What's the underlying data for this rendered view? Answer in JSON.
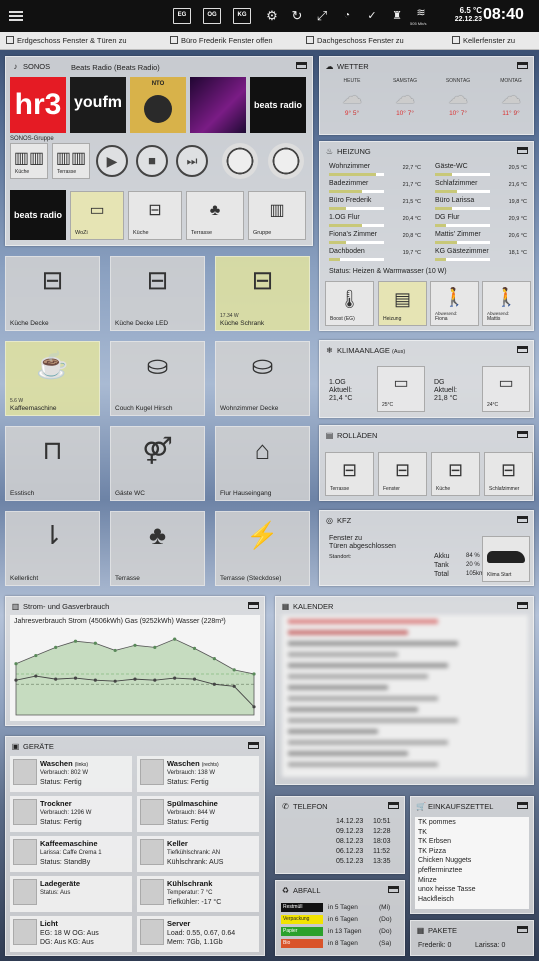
{
  "topbar": {
    "btn1": "EG",
    "btn2": "OG",
    "btn3": "KG",
    "temp": "6.5 °C",
    "date": "22.12.23",
    "time": "08:40",
    "wifi": "505 Mb/s"
  },
  "ticker": [
    "Erdgeschoss Fenster & Türen zu",
    "Büro Frederik Fenster offen",
    "Dachgeschoss Fenster zu",
    "Kellerfenster zu"
  ],
  "sonos": {
    "title": "SONOS",
    "now_playing": "Beats Radio (Beats Radio)",
    "stations": [
      "hr3",
      "youfm",
      "NTO",
      "",
      "beats radio"
    ],
    "group_label": "SONOS-Gruppe",
    "group": [
      "Küche",
      "Terrasse"
    ],
    "rooms": [
      "WoZi",
      "Küche",
      "Terrasse",
      "Gruppe"
    ],
    "logo": "beats radio"
  },
  "weather": {
    "title": "WETTER",
    "days": [
      {
        "d": "HEUTE",
        "lo": "9°",
        "hi": "5°"
      },
      {
        "d": "SAMSTAG",
        "lo": "10°",
        "hi": "7°"
      },
      {
        "d": "SONNTAG",
        "lo": "10°",
        "hi": "7°"
      },
      {
        "d": "MONTAG",
        "lo": "11°",
        "hi": "9°"
      }
    ]
  },
  "heating": {
    "title": "HEIZUNG",
    "left": [
      {
        "n": "Wohnzimmer",
        "v": "22,7 °C",
        "p": 0.85
      },
      {
        "n": "Badezimmer",
        "v": "21,7 °C",
        "p": 0.6
      },
      {
        "n": "Büro Frederik",
        "v": "21,5 °C",
        "p": 0.3
      },
      {
        "n": "1.OG Flur",
        "v": "20,4 °C",
        "p": 0.6
      },
      {
        "n": "Fiona's Zimmer",
        "v": "20,8 °C",
        "p": 0.3
      },
      {
        "n": "Dachboden",
        "v": "19,7 °C",
        "p": 0.2
      }
    ],
    "right": [
      {
        "n": "Gäste-WC",
        "v": "20,5 °C",
        "p": 0.3
      },
      {
        "n": "Schlafzimmer",
        "v": "21,6 °C",
        "p": 0.4
      },
      {
        "n": "Büro Larissa",
        "v": "19,8 °C",
        "p": 0.3
      },
      {
        "n": "DG Flur",
        "v": "20,9 °C",
        "p": 0.2
      },
      {
        "n": "Mattis' Zimmer",
        "v": "20,6 °C",
        "p": 0.4
      },
      {
        "n": "KG Gästezimmer",
        "v": "18,1 °C",
        "p": 0.2
      }
    ],
    "status": "Status: Heizen & Warmwasser (10 W)",
    "buttons": [
      "Boost (EG)",
      "Heizung",
      "Fiona",
      "Mattis"
    ],
    "away": "Abwesend:"
  },
  "climate": {
    "title": "KLIMAANLAGE",
    "sub": "(Aus)",
    "units": [
      {
        "n": "1.OG",
        "a": "Aktuell:",
        "t": "21,4 °C",
        "set": "25°C"
      },
      {
        "n": "DG",
        "a": "Aktuell:",
        "t": "21,8 °C",
        "set": "24°C"
      }
    ]
  },
  "shutters": {
    "title": "ROLLÄDEN",
    "items": [
      "Terrasse",
      "Fenster",
      "Küche",
      "Schlafzimmer"
    ]
  },
  "car": {
    "title": "KFZ",
    "line1": "Fenster zu",
    "line2": "Türen abgeschlossen",
    "loc": "Standort:",
    "akku": "Akku",
    "akku_v": "84 %",
    "tank": "Tank",
    "tank_v": "20 %",
    "total": "Total",
    "total_v": "105km",
    "btn": "Klima Start"
  },
  "tiles": [
    {
      "n": "Küche Decke",
      "s": ""
    },
    {
      "n": "Küche Decke LED",
      "s": ""
    },
    {
      "n": "Küche Schrank",
      "s": "17.34 W"
    },
    {
      "n": "Kaffeemaschine",
      "s": "5.6 W"
    },
    {
      "n": "Couch Kugel Hirsch",
      "s": ""
    },
    {
      "n": "Wohnzimmer Decke",
      "s": ""
    },
    {
      "n": "Esstisch",
      "s": ""
    },
    {
      "n": "Gäste WC",
      "s": ""
    },
    {
      "n": "Flur Hauseingang",
      "s": ""
    },
    {
      "n": "Kellerlicht",
      "s": ""
    },
    {
      "n": "Terrasse",
      "s": ""
    },
    {
      "n": "Terrasse (Steckdose)",
      "s": ""
    }
  ],
  "energy": {
    "title": "Strom- und Gasverbrauch",
    "caption": "Jahresverbrauch Strom (4506kWh) Gas (9252kWh) Wasser (228m³)"
  },
  "chart_data": {
    "type": "area",
    "series": [
      {
        "values": [
          50,
          58,
          66,
          72,
          70,
          63,
          68,
          66,
          74,
          65,
          55,
          44,
          40
        ]
      },
      {
        "values": [
          34,
          38,
          35,
          36,
          34,
          33,
          35,
          34,
          36,
          35,
          30,
          28,
          8
        ]
      }
    ]
  },
  "calendar": {
    "title": "KALENDER"
  },
  "devices": {
    "title": "GERÄTE",
    "items": [
      {
        "t": "Waschen",
        "tt": "(links)",
        "l1": "Verbrauch: 802 W",
        "l2": "Status: Fertig"
      },
      {
        "t": "Waschen",
        "tt": "(rechts)",
        "l1": "Verbrauch: 138 W",
        "l2": "Status: Fertig"
      },
      {
        "t": "Trockner",
        "tt": "",
        "l1": "Verbrauch: 1296 W",
        "l2": "Status: Fertig"
      },
      {
        "t": "Spülmaschine",
        "tt": "",
        "l1": "Verbrauch: 844 W",
        "l2": "Status: Fertig"
      },
      {
        "t": "Kaffeemaschine",
        "tt": "",
        "l1": "Larissa: Caffe Crema 1",
        "l2": "Status: StandBy"
      },
      {
        "t": "Keller",
        "tt": "",
        "l1": "Tiefkühlschrank: AN",
        "l2": "Kühlschrank: AUS"
      },
      {
        "t": "Ladegeräte",
        "tt": "",
        "l1": "Status: Aus",
        "l2": ""
      },
      {
        "t": "Kühlschrank",
        "tt": "",
        "l1": "Temperatur: 7 °C",
        "l2": "Tiefkühler: -17 °C"
      },
      {
        "t": "Licht",
        "tt": "",
        "l1": "EG: 18 W OG: Aus",
        "l2": "DG: Aus KG: Aus"
      },
      {
        "t": "Server",
        "tt": "",
        "l1": "Load: 0.55, 0.67, 0.64",
        "l2": "Mem: 7Gb, 1.1Gb"
      }
    ]
  },
  "phone": {
    "title": "TELEFON",
    "calls": [
      {
        "d": "14.12.23",
        "t": "10:51"
      },
      {
        "d": "09.12.23",
        "t": "12:28"
      },
      {
        "d": "08.12.23",
        "t": "18:03"
      },
      {
        "d": "06.12.23",
        "t": "11:52"
      },
      {
        "d": "05.12.23",
        "t": "13:35"
      }
    ]
  },
  "waste": {
    "title": "ABFALL",
    "items": [
      {
        "n": "Restmüll",
        "w": "in 5 Tagen",
        "d": "(Mi)",
        "c": "#111111"
      },
      {
        "n": "Verpackung",
        "w": "in 6 Tagen",
        "d": "(Do)",
        "c": "#f2e300"
      },
      {
        "n": "Papier",
        "w": "in 13 Tagen",
        "d": "(Do)",
        "c": "#2ba12b"
      },
      {
        "n": "Bio",
        "w": "in 8 Tagen",
        "d": "(Sa)",
        "c": "#d9542a"
      }
    ]
  },
  "shopping": {
    "title": "EINKAUFSZETTEL",
    "items": [
      "TK pommes",
      "TK",
      "TK Erbsen",
      "TK Pizza",
      "Chicken Nuggets",
      "pfefferminztee",
      "Minze",
      "unox heisse Tasse",
      "Hackfleisch"
    ]
  },
  "parcels": {
    "title": "PAKETE",
    "frederik": "Frederik: 0",
    "larissa": "Larissa: 0"
  }
}
